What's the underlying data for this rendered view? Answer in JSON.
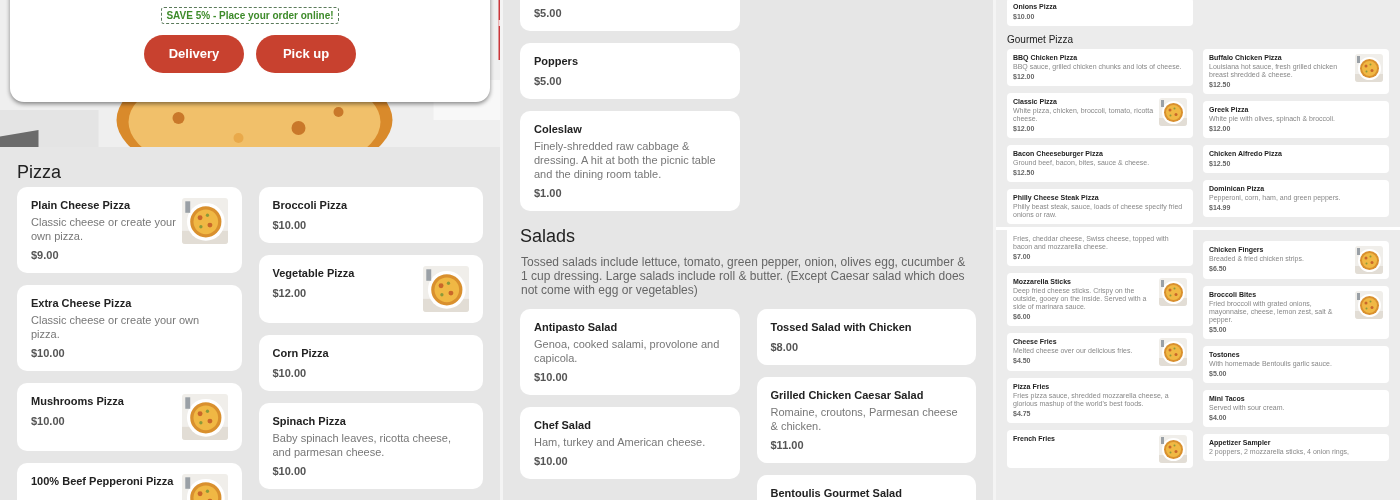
{
  "panels": [
    {
      "kind": "full",
      "blocks": [
        {
          "kind": "hero",
          "promo": "SAVE 5% - Place your order online!",
          "buttons": [
            "Delivery",
            "Pick up"
          ]
        },
        {
          "kind": "heading",
          "text": "Pizza"
        },
        {
          "kind": "columns",
          "columns": [
            [
              {
                "name": "Plain Cheese Pizza",
                "description": "Classic cheese or create your own pizza.",
                "price": "$9.00",
                "photo": true
              },
              {
                "name": "Extra Cheese Pizza",
                "description": "Classic cheese or create your own pizza.",
                "price": "$10.00",
                "photo": false
              },
              {
                "name": "Mushrooms Pizza",
                "price": "$10.00",
                "photo": true
              },
              {
                "name": "100% Beef Pepperoni Pizza",
                "photo": true
              }
            ],
            [
              {
                "name": "Broccoli Pizza",
                "price": "$10.00",
                "photo": false
              },
              {
                "name": "Vegetable Pizza",
                "price": "$12.00",
                "photo": true
              },
              {
                "name": "Corn Pizza",
                "price": "$10.00",
                "photo": false
              },
              {
                "name": "Spinach Pizza",
                "description": "Baby spinach leaves, ricotta cheese, and parmesan cheese.",
                "price": "$10.00",
                "photo": false
              }
            ]
          ]
        }
      ]
    },
    {
      "kind": "full",
      "blocks": [
        {
          "kind": "columns",
          "columns": [
            [
              {
                "price": "$5.00",
                "photo": false
              },
              {
                "name": "Poppers",
                "price": "$5.00",
                "photo": false
              },
              {
                "name": "Coleslaw",
                "description": "Finely-shredded raw cabbage & dressing. A hit at both the picnic table and the dining room table.",
                "price": "$1.00",
                "photo": false
              }
            ],
            []
          ]
        },
        {
          "kind": "heading",
          "text": "Salads"
        },
        {
          "kind": "note",
          "text": "Tossed salads include lettuce, tomato, green pepper, onion, olives egg, cucumber & 1 cup dressing. Large salads include roll & butter. (Except Caesar salad which does not come with egg or vegetables)"
        },
        {
          "kind": "columns",
          "columns": [
            [
              {
                "name": "Antipasto Salad",
                "description": "Genoa, cooked salami, provolone and capicola.",
                "price": "$10.00",
                "photo": false
              },
              {
                "name": "Chef Salad",
                "description": "Ham, turkey and American cheese.",
                "price": "$10.00",
                "photo": false
              }
            ],
            [
              {
                "name": "Tossed Salad with Chicken",
                "price": "$8.00",
                "photo": false
              },
              {
                "name": "Grilled Chicken Caesar Salad",
                "description": "Romaine, croutons, Parmesan cheese & chicken.",
                "price": "$11.00",
                "photo": false
              },
              {
                "name": "Bentoulis Gourmet Salad",
                "photo": false
              }
            ]
          ]
        }
      ]
    },
    {
      "kind": "compact",
      "blocks": [
        {
          "kind": "columns",
          "columns": [
            [
              {
                "name": "Onions Pizza",
                "price": "$10.00",
                "photo": false
              }
            ],
            []
          ]
        },
        {
          "kind": "heading",
          "text": "Gourmet Pizza"
        },
        {
          "kind": "columns",
          "columns": [
            [
              {
                "name": "BBQ Chicken Pizza",
                "description": "BBQ sauce, grilled chicken chunks and lots of cheese.",
                "price": "$12.00",
                "photo": false
              },
              {
                "name": "Classic Pizza",
                "description": "White pizza, chicken, broccoli, tomato, ricotta cheese.",
                "price": "$12.00",
                "photo": true
              },
              {
                "name": "Bacon Cheeseburger Pizza",
                "description": "Ground beef, bacon, bites, sauce & cheese.",
                "price": "$12.50",
                "photo": false
              },
              {
                "name": "Philly Cheese Steak Pizza",
                "description": "Philly beast steak, sauce, loads of cheese specify fried onions or raw.",
                "photo": false
              }
            ],
            [
              {
                "name": "Buffalo Chicken Pizza",
                "description": "Louisiana hot sauce, fresh grilled chicken breast shredded & cheese.",
                "price": "$12.50",
                "photo": true
              },
              {
                "name": "Greek Pizza",
                "description": "White pie with olives, spinach & broccoli.",
                "price": "$12.00",
                "photo": false
              },
              {
                "name": "Chicken Alfredo Pizza",
                "price": "$12.50",
                "photo": false
              },
              {
                "name": "Dominican Pizza",
                "description": "Pepperoni, corn, ham, and green peppers.",
                "price": "$14.99",
                "photo": false
              }
            ]
          ]
        },
        {
          "kind": "break"
        },
        {
          "kind": "columns",
          "columns": [
            [
              {
                "description": "Fries, cheddar cheese, Swiss cheese, topped with bacon and mozzarella cheese.",
                "price": "$7.00",
                "photo": false
              },
              {
                "name": "Mozzarella Sticks",
                "description": "Deep fried cheese sticks. Crispy on the outside, gooey on the inside. Served with a side of marinara sauce.",
                "price": "$6.00",
                "photo": true
              },
              {
                "name": "Cheese Fries",
                "description": "Melted cheese over our delicious fries.",
                "price": "$4.50",
                "photo": true
              },
              {
                "name": "Pizza Fries",
                "description": "Fries pizza sauce, shredded mozzarella cheese, a glorious mashup of the world's best foods.",
                "price": "$4.75",
                "photo": false
              },
              {
                "name": "French Fries",
                "photo": true
              }
            ],
            [
              {
                "name": "Chicken Fingers",
                "description": "Breaded & fried chicken strips.",
                "price": "$6.50",
                "photo": true
              },
              {
                "name": "Broccoli Bites",
                "description": "Fried broccoli with grated onions, mayonnaise, cheese, lemon zest, salt & pepper.",
                "price": "$5.00",
                "photo": true
              },
              {
                "name": "Tostones",
                "description": "With homemade Bentoulis garlic sauce.",
                "price": "$5.00",
                "photo": false
              },
              {
                "name": "Mini Tacos",
                "description": "Served with sour cream.",
                "price": "$4.00",
                "photo": false
              },
              {
                "name": "Appetizer Sampler",
                "description": "2 poppers, 2 mozzarella sticks, 4 onion rings,",
                "photo": false
              }
            ]
          ]
        }
      ]
    }
  ]
}
